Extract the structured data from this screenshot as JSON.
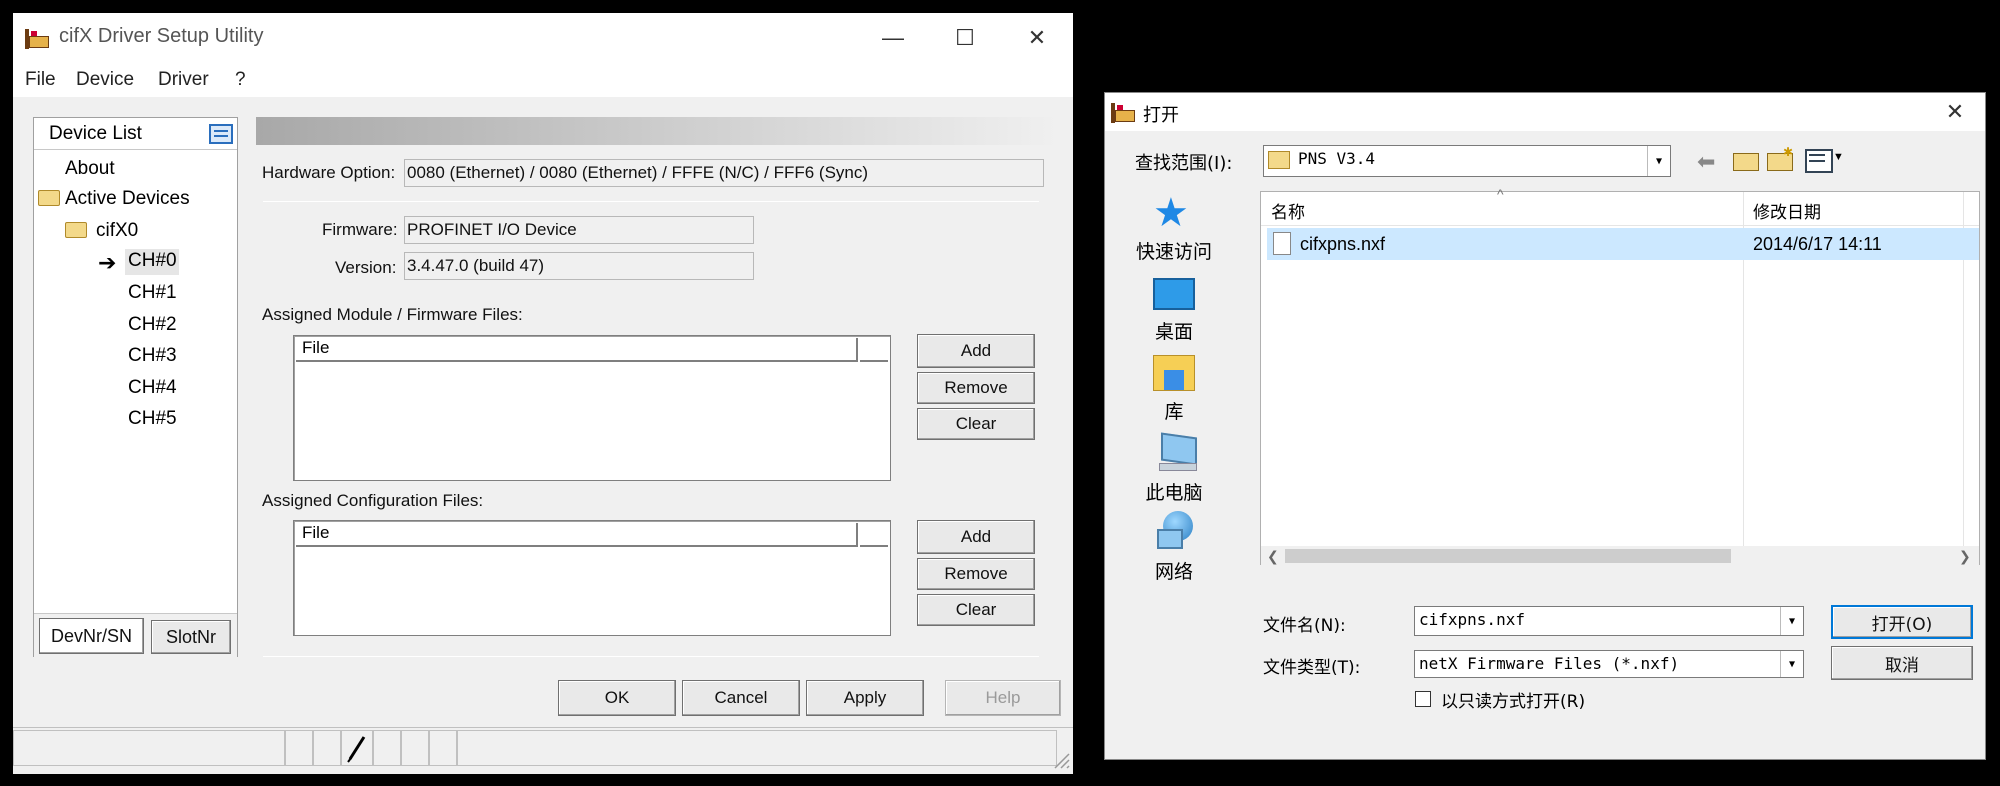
{
  "main_window": {
    "title": "cifX Driver Setup Utility",
    "minimize_glyph": "—",
    "maximize_glyph": "☐",
    "close_glyph": "✕",
    "menu": [
      "File",
      "Device",
      "Driver",
      "?"
    ],
    "device_list": {
      "header": "Device List",
      "items": {
        "about": "About",
        "active_devices": "Active Devices",
        "cifx0": "cifX0",
        "channels": [
          "CH#0",
          "CH#1",
          "CH#2",
          "CH#3",
          "CH#4",
          "CH#5"
        ]
      },
      "selected_channel": "CH#0",
      "tabs": [
        "DevNr/SN",
        "SlotNr"
      ]
    },
    "hardware_option_label": "Hardware Option:",
    "hardware_option_value": "0080 (Ethernet) / 0080 (Ethernet) / FFFE (N/C) / FFF6 (Sync)",
    "firmware_label": "Firmware:",
    "firmware_value": "PROFINET I/O Device",
    "version_label": "Version:",
    "version_value": "3.4.47.0 (build 47)",
    "module_files": {
      "label": "Assigned Module / Firmware Files:",
      "column": "File",
      "add": "Add",
      "remove": "Remove",
      "clear": "Clear"
    },
    "config_files": {
      "label": "Assigned Configuration Files:",
      "column": "File",
      "add": "Add",
      "remove": "Remove",
      "clear": "Clear"
    },
    "buttons": {
      "ok": "OK",
      "cancel": "Cancel",
      "apply": "Apply",
      "help": "Help"
    }
  },
  "open_dialog": {
    "title": "打开",
    "close_glyph": "✕",
    "look_in_label": "查找范围(I):",
    "look_in_value": "PNS V3.4",
    "nav": [
      "快速访问",
      "桌面",
      "库",
      "此电脑",
      "网络"
    ],
    "columns": {
      "name": "名称",
      "date": "修改日期"
    },
    "files": [
      {
        "name": "cifxpns.nxf",
        "date": "2014/6/17 14:11"
      }
    ],
    "filename_label": "文件名(N):",
    "filename_value": "cifxpns.nxf",
    "filetype_label": "文件类型(T):",
    "filetype_value": "netX Firmware Files (*.nxf)",
    "readonly_label": "以只读方式打开(R)",
    "open_button": "打开(O)",
    "cancel_button": "取消"
  },
  "colors": {
    "selection": "#cce8ff",
    "accent": "#0078d7",
    "window_bg": "#f0f0f0"
  }
}
